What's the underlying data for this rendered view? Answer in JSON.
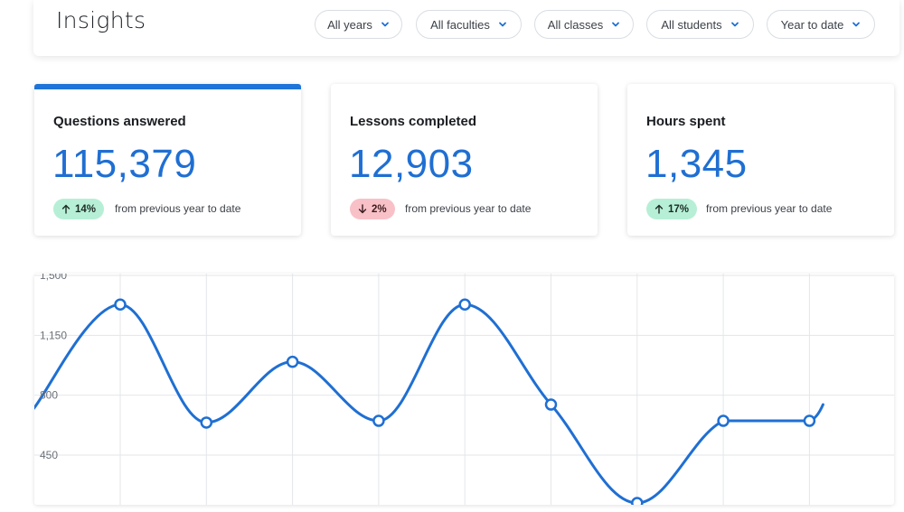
{
  "header": {
    "title": "Insights",
    "filters": [
      {
        "label": "All years"
      },
      {
        "label": "All faculties"
      },
      {
        "label": "All classes"
      },
      {
        "label": "All students"
      },
      {
        "label": "Year to date"
      }
    ]
  },
  "cards": [
    {
      "title": "Questions answered",
      "value": "115,379",
      "delta": "14%",
      "direction": "up",
      "note": "from previous year to date",
      "active": true
    },
    {
      "title": "Lessons completed",
      "value": "12,903",
      "delta": "2%",
      "direction": "down",
      "note": "from previous year to date",
      "active": false
    },
    {
      "title": "Hours spent",
      "value": "1,345",
      "delta": "17%",
      "direction": "up",
      "note": "from previous year to date",
      "active": false
    }
  ],
  "colors": {
    "accent": "#1f74d9",
    "positive_badge": "#b6efd6",
    "negative_badge": "#f8c1c7",
    "line": "#1f6fd3"
  },
  "chart_data": {
    "type": "line",
    "y_tick_labels": [
      "1,500",
      "1,150",
      "800",
      "450"
    ],
    "ylim": [
      170,
      1500
    ],
    "x": [
      0,
      1,
      2,
      3,
      4,
      5,
      6,
      7,
      8,
      9
    ],
    "values": [
      720,
      1330,
      640,
      995,
      650,
      1330,
      745,
      170,
      650,
      650
    ],
    "grid": true,
    "legend": "none"
  }
}
